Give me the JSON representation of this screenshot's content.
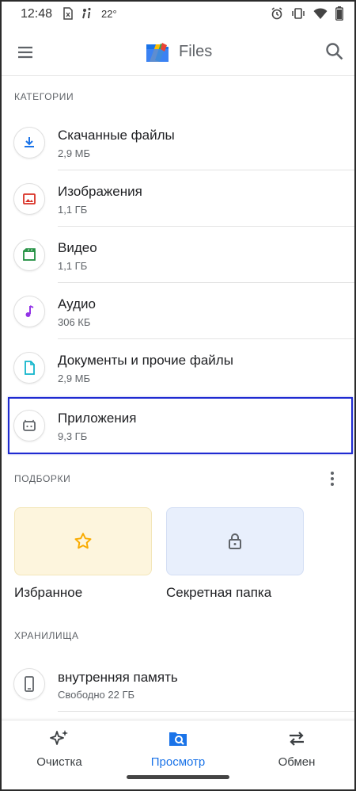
{
  "status_bar": {
    "time": "12:48",
    "temperature": "22°",
    "icons": [
      "sim-icon",
      "walk-icon",
      "alarm-icon",
      "vibrate-icon",
      "wifi-icon",
      "battery-icon"
    ]
  },
  "app_bar": {
    "title": "Files",
    "icons": [
      "menu-icon",
      "files-logo",
      "search-icon"
    ]
  },
  "categories": {
    "section_title": "КАТЕГОРИИ",
    "items": [
      {
        "title": "Скачанные файлы",
        "subtitle": "2,9 МБ",
        "icon": "download-icon",
        "color": "#1a73e8"
      },
      {
        "title": "Изображения",
        "subtitle": "1,1 ГБ",
        "icon": "image-icon",
        "color": "#d93025"
      },
      {
        "title": "Видео",
        "subtitle": "1,1 ГБ",
        "icon": "video-icon",
        "color": "#1e8e3e"
      },
      {
        "title": "Аудио",
        "subtitle": "306 КБ",
        "icon": "audio-icon",
        "color": "#9334e6"
      },
      {
        "title": "Документы и прочие файлы",
        "subtitle": "2,9 МБ",
        "icon": "document-icon",
        "color": "#12b5cb"
      },
      {
        "title": "Приложения",
        "subtitle": "9,3 ГБ",
        "icon": "android-icon",
        "color": "#5f6368"
      }
    ]
  },
  "collections": {
    "section_title": "ПОДБОРКИ",
    "tiles": [
      {
        "label": "Избранное",
        "icon": "star-icon",
        "color": "#f9ab00"
      },
      {
        "label": "Секретная папка",
        "icon": "lock-icon",
        "color": "#5f6368"
      }
    ]
  },
  "storage": {
    "section_title": "ХРАНИЛИЩА",
    "items": [
      {
        "title": "внутренняя память",
        "subtitle": "Свободно 22 ГБ",
        "icon": "phone-icon"
      }
    ]
  },
  "bottom_nav": {
    "items": [
      {
        "label": "Очистка",
        "icon": "sparkle-icon",
        "active": false
      },
      {
        "label": "Просмотр",
        "icon": "browse-icon",
        "active": true
      },
      {
        "label": "Обмен",
        "icon": "swap-icon",
        "active": false
      }
    ]
  },
  "colors": {
    "accent": "#1a73e8",
    "highlight_box": "#1f2bd1"
  }
}
